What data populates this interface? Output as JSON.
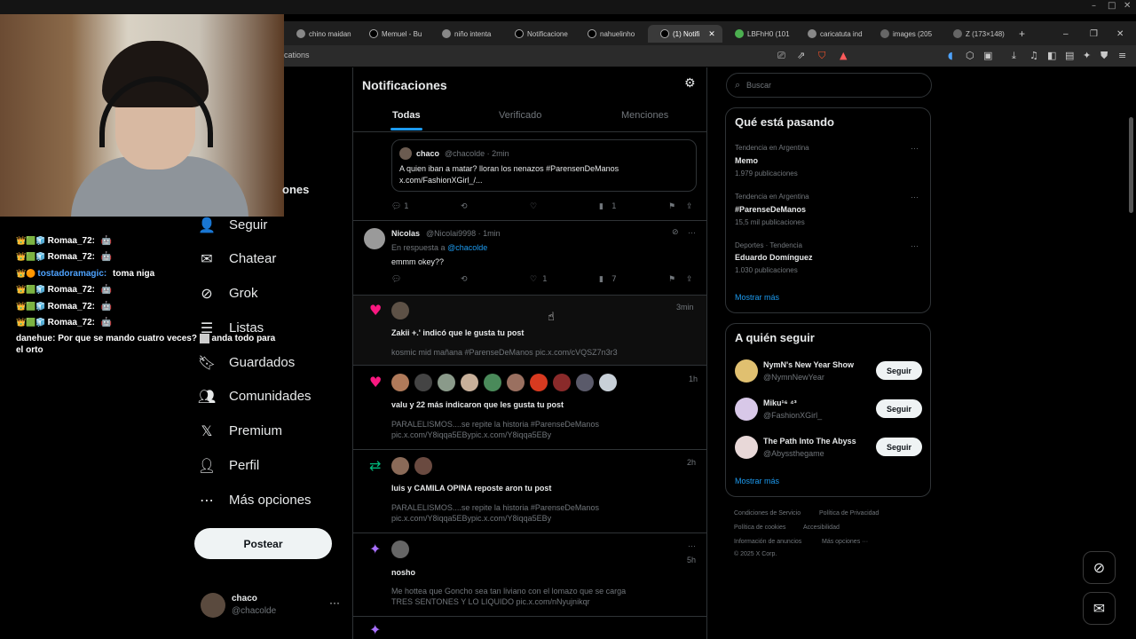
{
  "tabs": [
    "chino maidan",
    "Memuel - Bu",
    "niño intenta",
    "Notificacione",
    "nahuelinho",
    "(1) Notifi",
    "LBFhH0 (101",
    "caricatuta ind",
    "images (205",
    "Z (173×148)"
  ],
  "url_fragment": "cations",
  "chat": {
    "messages": [
      {
        "user": "Romaa_72:",
        "msg": "🤖"
      },
      {
        "user": "Romaa_72:",
        "msg": "🤖"
      },
      {
        "user": "tostadoramagic:",
        "msg": "toma niga",
        "user_color": "#4ea3ff"
      },
      {
        "user": "Romaa_72:",
        "msg": "🤖"
      },
      {
        "user": "Romaa_72:",
        "msg": "🤖"
      },
      {
        "user": "Romaa_72:",
        "msg": "🤖"
      }
    ],
    "last": {
      "user": "danehue:",
      "msg_a": "Por que se mando cuatro veces?",
      "msg_b": "anda todo para el orto"
    }
  },
  "nav": {
    "partial_label": "ones",
    "seguir": "Seguir",
    "chatear": "Chatear",
    "grok": "Grok",
    "listas": "Listas",
    "guardados": "Guardados",
    "comunidades": "Comunidades",
    "premium": "Premium",
    "perfil": "Perfil",
    "mas": "Más opciones",
    "post": "Postear"
  },
  "account": {
    "name": "chaco",
    "handle": "@chacolde"
  },
  "main": {
    "title": "Notificaciones",
    "tabs": {
      "all": "Todas",
      "verified": "Verificado",
      "mentions": "Menciones"
    },
    "quote": {
      "name": "chaco",
      "meta": "@chacolde · 2min",
      "line1": "A quien iban a matar? lloran los nenazos #ParensenDeManos",
      "line2": "x.com/FashionXGirl_/..."
    },
    "quote_actions": {
      "replies": "1",
      "views": "1"
    },
    "reply": {
      "name": "Nicolas",
      "meta": "@Nicolai9998 · 1min",
      "reply_to": "En respuesta a",
      "reply_handle": "@chacolde",
      "text": "emmm okey??"
    },
    "reply_actions": {
      "likes": "1",
      "views": "7"
    },
    "n1": {
      "time": "3min",
      "text": "Zakii +.' indicó que le gusta tu post",
      "body": "kosmic mid mañana #ParenseDeManos pic.x.com/cVQSZ7n3r3"
    },
    "n2": {
      "time": "1h",
      "text": "valu y 22 más indicaron que les gusta tu post",
      "body1": "PARALELISMOS....se repite la historia #ParenseDeManos",
      "body2": "pic.x.com/Y8iqqa5EBypic.x.com/Y8iqqa5EBy"
    },
    "n3": {
      "time": "2h",
      "text": "luis y CAMILA OPINA reposte aron tu post",
      "body1": "PARALELISMOS....se repite la historia #ParenseDeManos",
      "body2": "pic.x.com/Y8iqqa5EBypic.x.com/Y8iqqa5EBy"
    },
    "n4": {
      "time": "5h",
      "text": "nosho",
      "body1": "Me hottea que Goncho sea tan liviano con el lomazo que se carga",
      "body2": "TRES SENTONES Y LO LIQUIDO pic.x.com/nNyujnikqr"
    }
  },
  "right": {
    "search_placeholder": "Buscar",
    "trends_title": "Qué está pasando",
    "trends": [
      {
        "meta": "Tendencia en Argentina",
        "name": "Memo",
        "count": "1.979 publicaciones"
      },
      {
        "meta": "Tendencia en Argentina",
        "name": "#ParenseDeManos",
        "count": "15,5 mil publicaciones"
      },
      {
        "meta": "Deportes · Tendencia",
        "name": "Eduardo Domínguez",
        "count": "1.030 publicaciones"
      }
    ],
    "show_more": "Mostrar más",
    "follow_title": "A quién seguir",
    "follow": [
      {
        "name": "NymN's New Year Show",
        "handle": "@NymnNewYear",
        "btn": "Seguir"
      },
      {
        "name": "Miku¹⁶ ⁴³",
        "handle": "@FashionXGirl_",
        "btn": "Seguir"
      },
      {
        "name": "The Path Into The Abyss",
        "handle": "@Abyssthegame",
        "btn": "Seguir"
      }
    ],
    "footer": {
      "terms": "Condiciones de Servicio",
      "privacy": "Política de Privacidad",
      "cookies": "Política de cookies",
      "access": "Accesibilidad",
      "ads": "Información de anuncios",
      "more": "Más opciones ···",
      "copy": "© 2025 X Corp."
    }
  }
}
